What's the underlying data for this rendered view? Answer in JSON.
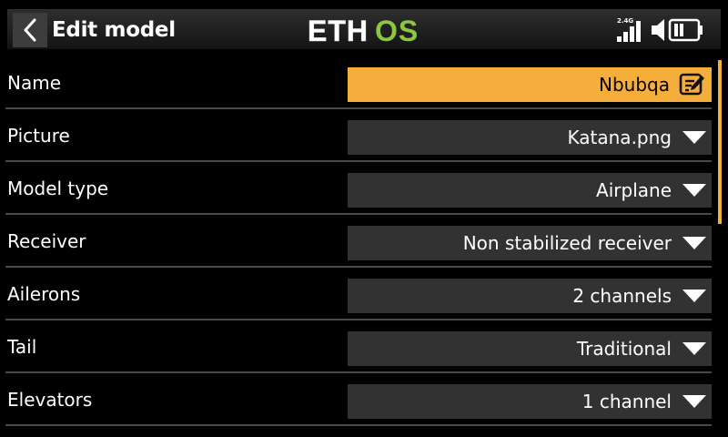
{
  "header": {
    "title": "Edit model",
    "logo_text": "ETH",
    "logo_accent_text": "OS",
    "back_icon": "chevron-left-icon",
    "status": {
      "band_label": "2.4G",
      "icons": [
        "signal-bars-icon",
        "speaker-icon",
        "battery-icon"
      ]
    }
  },
  "rows": [
    {
      "label": "Name",
      "value": "Nbubqa",
      "control": "text",
      "icon": "edit-icon"
    },
    {
      "label": "Picture",
      "value": "Katana.png",
      "control": "dropdown",
      "icon": "chevron-down-icon"
    },
    {
      "label": "Model type",
      "value": "Airplane",
      "control": "dropdown",
      "icon": "chevron-down-icon"
    },
    {
      "label": "Receiver",
      "value": "Non stabilized receiver",
      "control": "dropdown",
      "icon": "chevron-down-icon"
    },
    {
      "label": "Ailerons",
      "value": "2 channels",
      "control": "dropdown",
      "icon": "chevron-down-icon"
    },
    {
      "label": "Tail",
      "value": "Traditional",
      "control": "dropdown",
      "icon": "chevron-down-icon"
    },
    {
      "label": "Elevators",
      "value": "1 channel",
      "control": "dropdown",
      "icon": "chevron-down-icon"
    }
  ],
  "colors": {
    "accent": "#f5ad3b",
    "logo_green": "#8dc63f",
    "field_bg": "#323232",
    "background": "#000000"
  }
}
